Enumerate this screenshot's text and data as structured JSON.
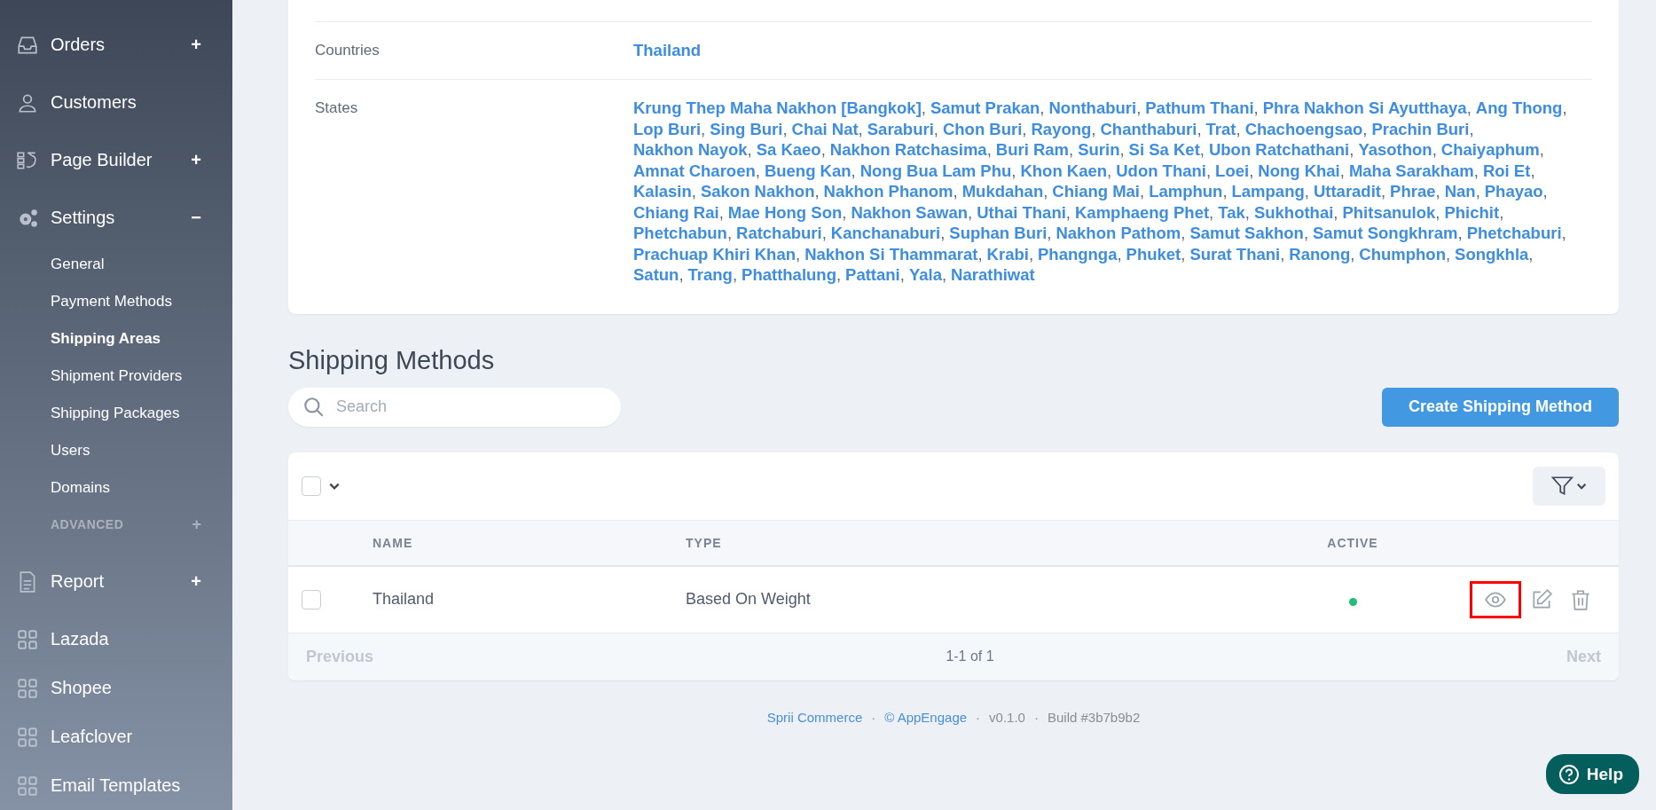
{
  "sidebar": {
    "items": [
      {
        "label": "Orders",
        "toggle": "+"
      },
      {
        "label": "Customers"
      },
      {
        "label": "Page Builder",
        "toggle": "+"
      },
      {
        "label": "Settings",
        "toggle": "−",
        "children": [
          {
            "label": "General",
            "kind": "link",
            "selected": false
          },
          {
            "label": "Payment Methods",
            "kind": "link",
            "selected": false
          },
          {
            "label": "Shipping Areas",
            "kind": "link",
            "selected": true
          },
          {
            "label": "Shipment Providers",
            "kind": "link",
            "selected": false
          },
          {
            "label": "Shipping Packages",
            "kind": "link",
            "selected": false
          },
          {
            "label": "Users",
            "kind": "link",
            "selected": false
          },
          {
            "label": "Domains",
            "kind": "link",
            "selected": false
          },
          {
            "label": "ADVANCED",
            "kind": "group",
            "toggle": "+"
          }
        ]
      },
      {
        "label": "Report",
        "toggle": "+"
      },
      {
        "label": "Lazada"
      },
      {
        "label": "Shopee"
      },
      {
        "label": "Leafclover"
      },
      {
        "label": "Email Templates"
      }
    ]
  },
  "area": {
    "separator": ",",
    "countries_label": "Countries",
    "countries": [
      "Thailand"
    ],
    "states_label": "States",
    "states": [
      "Krung Thep Maha Nakhon [Bangkok]",
      "Samut Prakan",
      "Nonthaburi",
      "Pathum Thani",
      "Phra Nakhon Si Ayutthaya",
      "Ang Thong",
      "Lop Buri",
      "Sing Buri",
      "Chai Nat",
      "Saraburi",
      "Chon Buri",
      "Rayong",
      "Chanthaburi",
      "Trat",
      "Chachoengsao",
      "Prachin Buri",
      "Nakhon Nayok",
      "Sa Kaeo",
      "Nakhon Ratchasima",
      "Buri Ram",
      "Surin",
      "Si Sa Ket",
      "Ubon Ratchathani",
      "Yasothon",
      "Chaiyaphum",
      "Amnat Charoen",
      "Bueng Kan",
      "Nong Bua Lam Phu",
      "Khon Kaen",
      "Udon Thani",
      "Loei",
      "Nong Khai",
      "Maha Sarakham",
      "Roi Et",
      "Kalasin",
      "Sakon Nakhon",
      "Nakhon Phanom",
      "Mukdahan",
      "Chiang Mai",
      "Lamphun",
      "Lampang",
      "Uttaradit",
      "Phrae",
      "Nan",
      "Phayao",
      "Chiang Rai",
      "Mae Hong Son",
      "Nakhon Sawan",
      "Uthai Thani",
      "Kamphaeng Phet",
      "Tak",
      "Sukhothai",
      "Phitsanulok",
      "Phichit",
      "Phetchabun",
      "Ratchaburi",
      "Kanchanaburi",
      "Suphan Buri",
      "Nakhon Pathom",
      "Samut Sakhon",
      "Samut Songkhram",
      "Phetchaburi",
      "Prachuap Khiri Khan",
      "Nakhon Si Thammarat",
      "Krabi",
      "Phangnga",
      "Phuket",
      "Surat Thani",
      "Ranong",
      "Chumphon",
      "Songkhla",
      "Satun",
      "Trang",
      "Phatthalung",
      "Pattani",
      "Yala",
      "Narathiwat"
    ]
  },
  "shipping_methods": {
    "title": "Shipping Methods",
    "search": {
      "placeholder": "Search"
    },
    "create_button": "Create Shipping Method",
    "table": {
      "select_all": {
        "checked": false
      },
      "columns": [
        "NAME",
        "TYPE",
        "ACTIVE"
      ],
      "rows": [
        {
          "checked": false,
          "name": "Thailand",
          "type": "Based On Weight",
          "active": true,
          "actions": [
            {
              "kind": "view",
              "highlighted": true
            },
            {
              "kind": "edit",
              "highlighted": false
            },
            {
              "kind": "delete",
              "highlighted": false
            }
          ]
        }
      ]
    },
    "pagination": {
      "previous": {
        "label": "Previous",
        "disabled": true
      },
      "range": "1-1 of 1",
      "next": {
        "label": "Next",
        "disabled": true
      }
    }
  },
  "footer": {
    "links": [
      "Sprii Commerce",
      "© AppEngage"
    ],
    "version": "v0.1.0",
    "build": "Build #3b7b9b2",
    "separator": "·"
  },
  "help_button": "Help"
}
